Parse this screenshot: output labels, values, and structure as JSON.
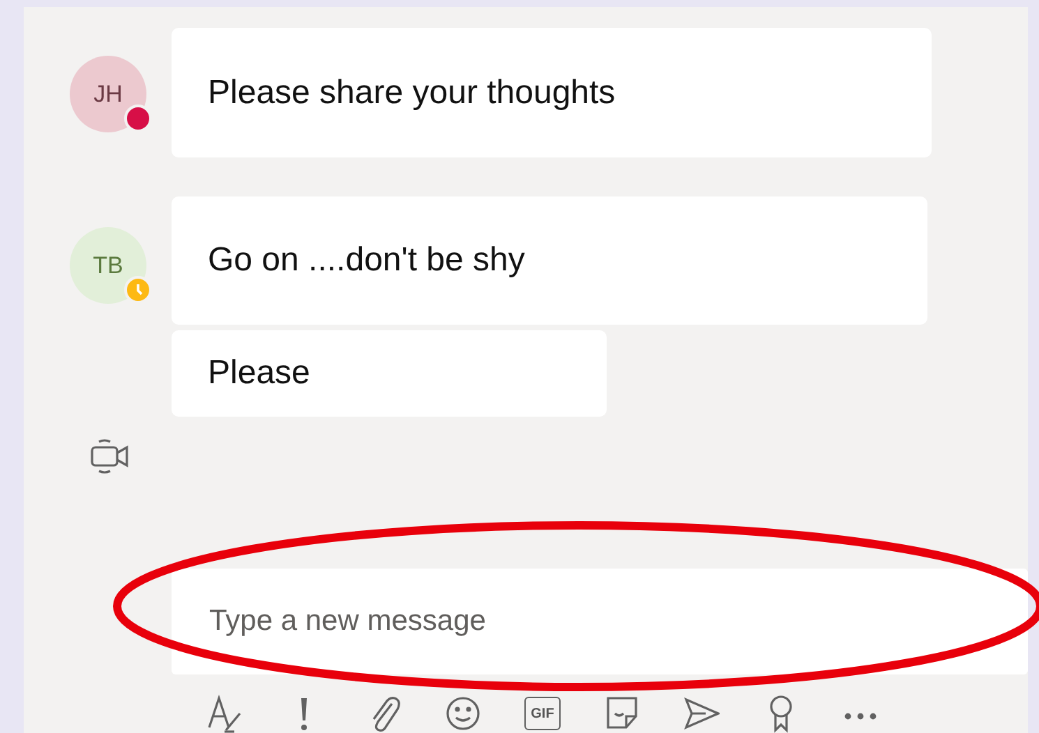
{
  "messages": [
    {
      "initials": "JH",
      "color": "#ecc9cf",
      "away": false,
      "text": "Please share your thoughts"
    },
    {
      "initials": "TB",
      "color": "#e2efd9",
      "away": true,
      "text": "Go on ....don't be shy"
    },
    {
      "text": "Please"
    }
  ],
  "compose": {
    "placeholder": "Type a new message"
  },
  "toolbar": [
    {
      "kind": "format"
    },
    {
      "kind": "important"
    },
    {
      "kind": "attach"
    },
    {
      "kind": "emoji"
    },
    {
      "kind": "gif",
      "label": "GIF"
    },
    {
      "kind": "sticker"
    },
    {
      "kind": "send"
    },
    {
      "kind": "praise"
    },
    {
      "kind": "more"
    }
  ],
  "highlight": {
    "kind": "ellipse"
  }
}
